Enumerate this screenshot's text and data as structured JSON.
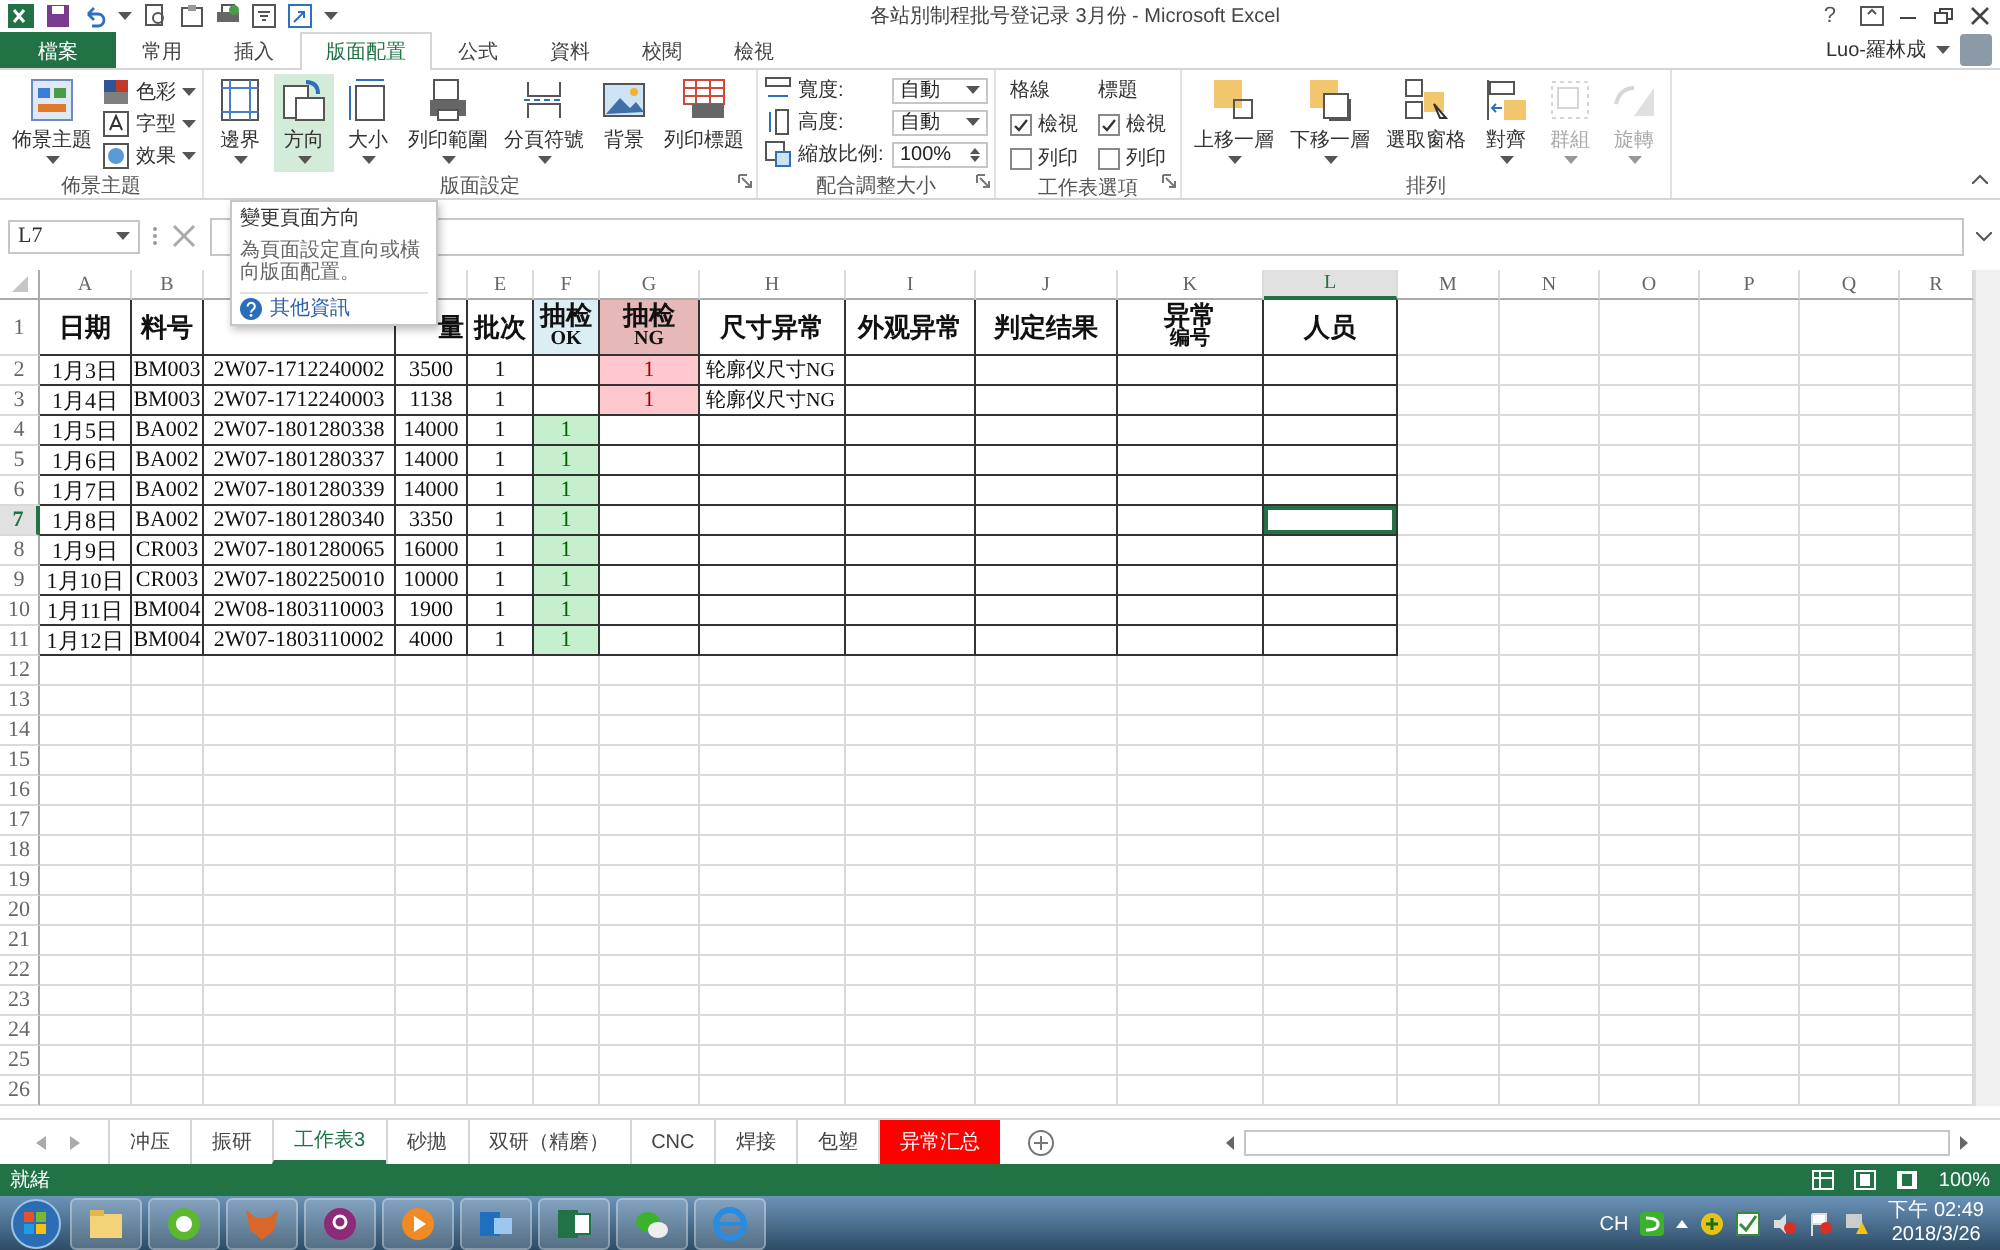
{
  "window": {
    "title": "各站別制程批号登记录 3月份 - Microsoft Excel",
    "help": "?",
    "user": "Luo-羅林成"
  },
  "ribbon": {
    "tabs": [
      {
        "label": "檔案",
        "kind": "file",
        "selected": false
      },
      {
        "label": "常用",
        "kind": "tab",
        "selected": false
      },
      {
        "label": "插入",
        "kind": "tab",
        "selected": false
      },
      {
        "label": "版面配置",
        "kind": "tab",
        "selected": true
      },
      {
        "label": "公式",
        "kind": "tab",
        "selected": false
      },
      {
        "label": "資料",
        "kind": "tab",
        "selected": false
      },
      {
        "label": "校閱",
        "kind": "tab",
        "selected": false
      },
      {
        "label": "檢視",
        "kind": "tab",
        "selected": false
      }
    ],
    "groups": [
      {
        "label": "佈景主題",
        "launcher": false,
        "items": [
          {
            "kind": "large",
            "label": "佈景主題",
            "dropdown": true,
            "highlighted": false,
            "disabled": false
          },
          {
            "kind": "smallstack",
            "entries": [
              {
                "label": "色彩"
              },
              {
                "label": "字型"
              },
              {
                "label": "效果"
              }
            ]
          }
        ]
      },
      {
        "label": "版面設定",
        "launcher": true,
        "items": [
          {
            "kind": "large",
            "label": "邊界",
            "dropdown": true,
            "highlighted": false,
            "disabled": false
          },
          {
            "kind": "large",
            "label": "方向",
            "dropdown": true,
            "highlighted": true,
            "disabled": false
          },
          {
            "kind": "large",
            "label": "大小",
            "dropdown": true,
            "highlighted": false,
            "disabled": false
          },
          {
            "kind": "large",
            "label": "列印範圍",
            "dropdown": true,
            "highlighted": false,
            "disabled": false
          },
          {
            "kind": "large",
            "label": "分頁符號",
            "dropdown": true,
            "highlighted": false,
            "disabled": false
          },
          {
            "kind": "large",
            "label": "背景",
            "dropdown": false,
            "highlighted": false,
            "disabled": false
          },
          {
            "kind": "large",
            "label": "列印標題",
            "dropdown": false,
            "highlighted": false,
            "disabled": false
          }
        ]
      },
      {
        "label": "配合調整大小",
        "launcher": true,
        "items": [
          {
            "kind": "fields",
            "entries": [
              {
                "label": "寬度:",
                "value": "自動",
                "kind": "dropdown"
              },
              {
                "label": "高度:",
                "value": "自動",
                "kind": "dropdown"
              },
              {
                "label": "縮放比例:",
                "value": "100%",
                "kind": "spinner"
              }
            ]
          }
        ]
      },
      {
        "label": "工作表選項",
        "launcher": true,
        "items": [
          {
            "kind": "checks",
            "title": "格線",
            "options": [
              {
                "label": "檢視",
                "checked": true
              },
              {
                "label": "列印",
                "checked": false
              }
            ]
          },
          {
            "kind": "checks",
            "title": "標題",
            "options": [
              {
                "label": "檢視",
                "checked": true
              },
              {
                "label": "列印",
                "checked": false
              }
            ]
          }
        ]
      },
      {
        "label": "排列",
        "launcher": false,
        "items": [
          {
            "kind": "large",
            "label": "上移一層",
            "dropdown": true,
            "highlighted": false,
            "disabled": false
          },
          {
            "kind": "large",
            "label": "下移一層",
            "dropdown": true,
            "highlighted": false,
            "disabled": false
          },
          {
            "kind": "large",
            "label": "選取窗格",
            "dropdown": false,
            "highlighted": false,
            "disabled": false
          },
          {
            "kind": "large",
            "label": "對齊",
            "dropdown": true,
            "highlighted": false,
            "disabled": false
          },
          {
            "kind": "large",
            "label": "群組",
            "dropdown": true,
            "highlighted": false,
            "disabled": true
          },
          {
            "kind": "large",
            "label": "旋轉",
            "dropdown": true,
            "highlighted": false,
            "disabled": true
          }
        ]
      }
    ]
  },
  "tooltip": {
    "title": "變更頁面方向",
    "body": "為頁面設定直向或橫向版面配置。",
    "link": "其他資訊"
  },
  "formula_bar": {
    "name_box": "L7"
  },
  "sheet": {
    "columns": [
      {
        "letter": "A",
        "selected": false
      },
      {
        "letter": "B",
        "selected": false
      },
      {
        "selected": false
      },
      {
        "selected": false
      },
      {
        "letter": "E",
        "selected": false
      },
      {
        "letter": "F",
        "selected": false
      },
      {
        "letter": "G",
        "selected": false
      },
      {
        "letter": "H",
        "selected": false
      },
      {
        "letter": "I",
        "selected": false
      },
      {
        "letter": "J",
        "selected": false
      },
      {
        "letter": "K",
        "selected": false
      },
      {
        "letter": "L",
        "selected": true
      },
      {
        "letter": "M",
        "selected": false
      },
      {
        "letter": "N",
        "selected": false
      },
      {
        "letter": "O",
        "selected": false
      },
      {
        "letter": "P",
        "selected": false
      },
      {
        "letter": "Q",
        "selected": false
      },
      {
        "letter": "R",
        "selected": false
      }
    ],
    "rows": [
      {
        "number": "1",
        "selected": false,
        "cells": [
          {
            "kind": "header",
            "lines": [
              "日期"
            ]
          },
          {
            "kind": "header",
            "lines": [
              "料号"
            ]
          },
          {},
          {
            "kind": "header_cut",
            "lines": [
              "量"
            ]
          },
          {
            "kind": "header",
            "lines": [
              "批次"
            ]
          },
          {
            "kind": "header_ok",
            "lines": [
              "抽检",
              "OK"
            ]
          },
          {
            "kind": "header_ng",
            "lines": [
              "抽检",
              "NG"
            ]
          },
          {
            "kind": "header",
            "lines": [
              "尺寸异常"
            ]
          },
          {
            "kind": "header",
            "lines": [
              "外观异常"
            ]
          },
          {
            "kind": "header",
            "lines": [
              "判定结果"
            ]
          },
          {
            "kind": "header",
            "lines": [
              "异常",
              "编号"
            ]
          },
          {
            "kind": "header",
            "lines": [
              "人员"
            ]
          }
        ]
      },
      {
        "number": "2",
        "selected": false,
        "cells": [
          {
            "kind": "data",
            "text": "1月3日"
          },
          {
            "kind": "data",
            "text": "BM003"
          },
          {
            "kind": "data",
            "text": "2W07-1712240002"
          },
          {
            "kind": "data",
            "text": "3500"
          },
          {
            "kind": "data",
            "text": "1"
          },
          {},
          {
            "kind": "bad",
            "text": "1"
          },
          {
            "kind": "note",
            "text": "轮廓仪尺寸NG"
          },
          {},
          {},
          {},
          {}
        ]
      },
      {
        "number": "3",
        "selected": false,
        "cells": [
          {
            "kind": "data",
            "text": "1月4日"
          },
          {
            "kind": "data",
            "text": "BM003"
          },
          {
            "kind": "data",
            "text": "2W07-1712240003"
          },
          {
            "kind": "data",
            "text": "1138"
          },
          {
            "kind": "data",
            "text": "1"
          },
          {},
          {
            "kind": "bad",
            "text": "1"
          },
          {
            "kind": "note",
            "text": "轮廓仪尺寸NG"
          },
          {},
          {},
          {},
          {}
        ]
      },
      {
        "number": "4",
        "selected": false,
        "cells": [
          {
            "kind": "data",
            "text": "1月5日"
          },
          {
            "kind": "data",
            "text": "BA002"
          },
          {
            "kind": "data",
            "text": "2W07-1801280338"
          },
          {
            "kind": "data",
            "text": "14000"
          },
          {
            "kind": "data",
            "text": "1"
          },
          {
            "kind": "good",
            "text": "1"
          },
          {},
          {},
          {},
          {},
          {},
          {}
        ]
      },
      {
        "number": "5",
        "selected": false,
        "cells": [
          {
            "kind": "data",
            "text": "1月6日"
          },
          {
            "kind": "data",
            "text": "BA002"
          },
          {
            "kind": "data",
            "text": "2W07-1801280337"
          },
          {
            "kind": "data",
            "text": "14000"
          },
          {
            "kind": "data",
            "text": "1"
          },
          {
            "kind": "good",
            "text": "1"
          },
          {},
          {},
          {},
          {},
          {},
          {}
        ]
      },
      {
        "number": "6",
        "selected": false,
        "cells": [
          {
            "kind": "data",
            "text": "1月7日"
          },
          {
            "kind": "data",
            "text": "BA002"
          },
          {
            "kind": "data",
            "text": "2W07-1801280339"
          },
          {
            "kind": "data",
            "text": "14000"
          },
          {
            "kind": "data",
            "text": "1"
          },
          {
            "kind": "good",
            "text": "1"
          },
          {},
          {},
          {},
          {},
          {},
          {}
        ]
      },
      {
        "number": "7",
        "selected": true,
        "cells": [
          {
            "kind": "data",
            "text": "1月8日"
          },
          {
            "kind": "data",
            "text": "BA002"
          },
          {
            "kind": "data",
            "text": "2W07-1801280340"
          },
          {
            "kind": "data",
            "text": "3350"
          },
          {
            "kind": "data",
            "text": "1"
          },
          {
            "kind": "good",
            "text": "1"
          },
          {},
          {},
          {},
          {},
          {},
          {}
        ]
      },
      {
        "number": "8",
        "selected": false,
        "cells": [
          {
            "kind": "data",
            "text": "1月9日"
          },
          {
            "kind": "data",
            "text": "CR003"
          },
          {
            "kind": "data",
            "text": "2W07-1801280065"
          },
          {
            "kind": "data",
            "text": "16000"
          },
          {
            "kind": "data",
            "text": "1"
          },
          {
            "kind": "good",
            "text": "1"
          },
          {},
          {},
          {},
          {},
          {},
          {}
        ]
      },
      {
        "number": "9",
        "selected": false,
        "cells": [
          {
            "kind": "data",
            "text": "1月10日"
          },
          {
            "kind": "data",
            "text": "CR003"
          },
          {
            "kind": "data",
            "text": "2W07-1802250010"
          },
          {
            "kind": "data",
            "text": "10000"
          },
          {
            "kind": "data",
            "text": "1"
          },
          {
            "kind": "good",
            "text": "1"
          },
          {},
          {},
          {},
          {},
          {},
          {}
        ]
      },
      {
        "number": "10",
        "selected": false,
        "cells": [
          {
            "kind": "data",
            "text": "1月11日"
          },
          {
            "kind": "data",
            "text": "BM004"
          },
          {
            "kind": "data",
            "text": "2W08-1803110003"
          },
          {
            "kind": "data",
            "text": "1900"
          },
          {
            "kind": "data",
            "text": "1"
          },
          {
            "kind": "good",
            "text": "1"
          },
          {},
          {},
          {},
          {},
          {},
          {}
        ]
      },
      {
        "number": "11",
        "selected": false,
        "cells": [
          {
            "kind": "data",
            "text": "1月12日"
          },
          {
            "kind": "data",
            "text": "BM004"
          },
          {
            "kind": "data",
            "text": "2W07-1803110002"
          },
          {
            "kind": "data",
            "text": "4000"
          },
          {
            "kind": "data",
            "text": "1"
          },
          {
            "kind": "good",
            "text": "1"
          },
          {},
          {},
          {},
          {},
          {},
          {}
        ]
      },
      {
        "number": "12",
        "selected": false
      },
      {
        "number": "13",
        "selected": false
      },
      {
        "number": "14",
        "selected": false
      },
      {
        "number": "15",
        "selected": false
      },
      {
        "number": "16",
        "selected": false
      },
      {
        "number": "17",
        "selected": false
      },
      {
        "number": "18",
        "selected": false
      },
      {
        "number": "19",
        "selected": false
      },
      {
        "number": "20",
        "selected": false
      },
      {
        "number": "21",
        "selected": false
      },
      {
        "number": "22",
        "selected": false
      },
      {
        "number": "23",
        "selected": false
      },
      {
        "number": "24",
        "selected": false
      },
      {
        "number": "25",
        "selected": false
      },
      {
        "number": "26",
        "selected": false
      }
    ]
  },
  "sheet_tabs": [
    {
      "label": "冲压",
      "selected": false
    },
    {
      "label": "振研",
      "selected": false
    },
    {
      "label": "工作表3",
      "selected": true
    },
    {
      "label": "砂拋",
      "selected": false
    },
    {
      "label": "双研（精磨）",
      "selected": false
    },
    {
      "label": "CNC",
      "selected": false
    },
    {
      "label": "焊接",
      "selected": false
    },
    {
      "label": "包塑",
      "selected": false
    },
    {
      "label": "异常汇总",
      "selected": false,
      "color": "#ff0000"
    }
  ],
  "status_bar": {
    "status": "就緒",
    "zoom": "100%"
  },
  "taskbar": {
    "language": "CH",
    "time": "下午 02:49",
    "date": "2018/3/26"
  }
}
